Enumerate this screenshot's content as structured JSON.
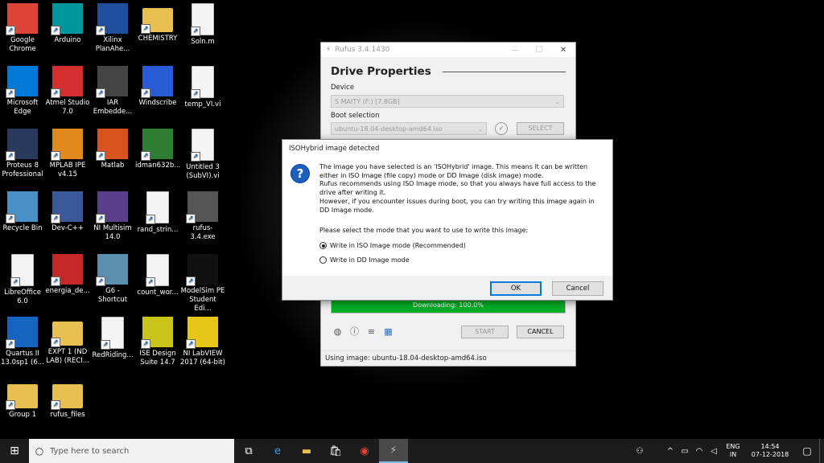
{
  "desktop": {
    "icons": [
      {
        "label": "Google Chrome",
        "icon": "chrome-icon",
        "color": "#db4437"
      },
      {
        "label": "Arduino",
        "icon": "arduino-icon",
        "color": "#00979c"
      },
      {
        "label": "Xilinx PlanAhe...",
        "icon": "xilinx-icon",
        "color": "#1e4f9c"
      },
      {
        "label": "CHEMISTRY",
        "icon": "folder-icon",
        "color": "#e8c052"
      },
      {
        "label": "Soln.m",
        "icon": "file-icon",
        "color": "#f4f4f4"
      },
      {
        "label": "Microsoft Edge",
        "icon": "edge-icon",
        "color": "#0078d7"
      },
      {
        "label": "Atmel Studio 7.0",
        "icon": "atmel-icon",
        "color": "#d32f2f"
      },
      {
        "label": "IAR Embedde...",
        "icon": "iar-icon",
        "color": "#444444"
      },
      {
        "label": "Windscribe",
        "icon": "windscribe-icon",
        "color": "#2a5bd7"
      },
      {
        "label": "temp_VI.vi",
        "icon": "labview-vi-icon",
        "color": "#f4f4f4"
      },
      {
        "label": "Proteus 8 Professional",
        "icon": "proteus-icon",
        "color": "#2a3a5c"
      },
      {
        "label": "MPLAB IPE v4.15",
        "icon": "mplab-icon",
        "color": "#e08a1e"
      },
      {
        "label": "Matlab",
        "icon": "matlab-icon",
        "color": "#d9531e"
      },
      {
        "label": "idman632b...",
        "icon": "idm-icon",
        "color": "#2e7d32"
      },
      {
        "label": "Untitled 3 (SubVI).vi",
        "icon": "labview-vi-icon",
        "color": "#f4f4f4"
      },
      {
        "label": "Recycle Bin",
        "icon": "recycle-bin-icon",
        "color": "#4a90c8"
      },
      {
        "label": "Dev-C++",
        "icon": "devcpp-icon",
        "color": "#3b5998"
      },
      {
        "label": "NI Multisim 14.0",
        "icon": "multisim-icon",
        "color": "#5a3e8c"
      },
      {
        "label": "rand_strin...",
        "icon": "file-icon",
        "color": "#f4f4f4"
      },
      {
        "label": "rufus-3.4.exe",
        "icon": "usb-drive-icon",
        "color": "#555555"
      },
      {
        "label": "LibreOffice 6.0",
        "icon": "libreoffice-icon",
        "color": "#f4f4f4"
      },
      {
        "label": "energia_de...",
        "icon": "energia-icon",
        "color": "#c62828"
      },
      {
        "label": "G6 - Shortcut",
        "icon": "g6-icon",
        "color": "#5a8fb0"
      },
      {
        "label": "count_wor...",
        "icon": "file-icon",
        "color": "#f4f4f4"
      },
      {
        "label": "ModelSim PE Student Edi...",
        "icon": "modelsim-icon",
        "color": "#111111"
      },
      {
        "label": "Quartus II 13.0sp1 (6...",
        "icon": "quartus-icon",
        "color": "#1565c0"
      },
      {
        "label": "EXPT 1 (ND LAB) (RECI...",
        "icon": "folder-icon",
        "color": "#e8c052"
      },
      {
        "label": "RedRiding...",
        "icon": "file-icon",
        "color": "#f4f4f4"
      },
      {
        "label": "ISE Design Suite 14.7",
        "icon": "ise-icon",
        "color": "#c9c41a"
      },
      {
        "label": "NI LabVIEW 2017 (64-bit)",
        "icon": "labview-icon",
        "color": "#e6c619"
      },
      {
        "label": "Group 1",
        "icon": "folder-icon",
        "color": "#e8c052"
      },
      {
        "label": "rufus_files",
        "icon": "folder-icon",
        "color": "#e8c052"
      }
    ]
  },
  "rufus": {
    "title": "Rufus 3.4.1430",
    "heading": "Drive Properties",
    "device_label": "Device",
    "device_value": "S MAITY (F:) [7.8GB]",
    "boot_label": "Boot selection",
    "boot_value": "ubuntu-18.04-desktop-amd64.iso",
    "select_label": "SELECT",
    "progress_text": "Downloading: 100.0%",
    "progress_fraction": 1.0,
    "start_label": "START",
    "cancel_label": "CANCEL",
    "status": "Using image: ubuntu-18.04-desktop-amd64.iso"
  },
  "dialog": {
    "title": "ISOHybrid image detected",
    "message": [
      "The image you have selected is an 'ISOHybrid' image. This means it can be written either in ISO Image (file copy) mode or DD Image (disk image) mode.",
      "Rufus recommends using ISO Image mode, so that you always have full access to the drive after writing it.",
      "However, if you encounter issues during boot, you can try writing this image again in DD Image mode."
    ],
    "prompt": "Please select the mode that you want to use to write this image:",
    "option_iso": "Write in ISO Image mode (Recommended)",
    "option_dd": "Write in DD Image mode",
    "selected": "iso",
    "ok_label": "OK",
    "cancel_label": "Cancel"
  },
  "taskbar": {
    "search_placeholder": "Type here to search",
    "lang_top": "ENG",
    "lang_bottom": "IN",
    "time": "14:54",
    "date": "07-12-2018"
  }
}
